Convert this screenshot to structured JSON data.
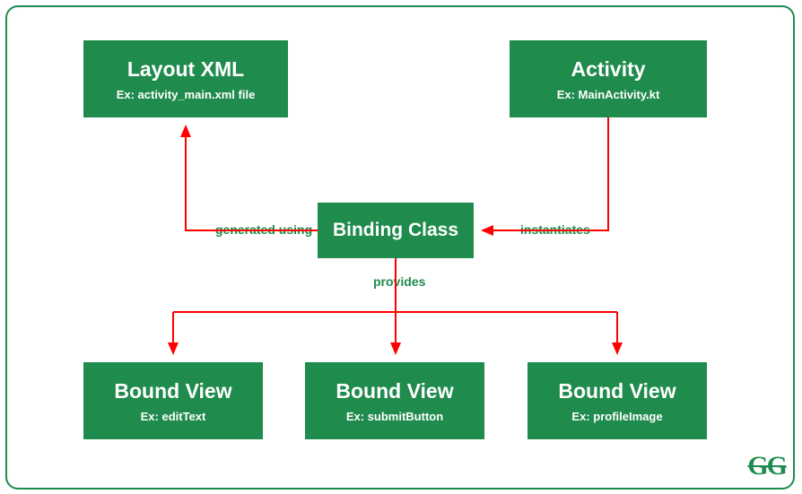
{
  "nodes": {
    "layout_xml": {
      "title": "Layout XML",
      "sub": "Ex: activity_main.xml file"
    },
    "activity": {
      "title": "Activity",
      "sub": "Ex: MainActivity.kt"
    },
    "binding": {
      "title": "Binding Class"
    },
    "bv1": {
      "title": "Bound View",
      "sub": "Ex: editText"
    },
    "bv2": {
      "title": "Bound View",
      "sub": "Ex: submitButton"
    },
    "bv3": {
      "title": "Bound View",
      "sub": "Ex: profileImage"
    }
  },
  "edges": {
    "gen": "generated using",
    "inst": "instantiates",
    "prov": "provides"
  },
  "logo": "GG",
  "colors": {
    "green": "#1f8b4c",
    "arrow": "#ff0000"
  },
  "chart_data": {
    "type": "flow-diagram",
    "nodes": [
      {
        "id": "layout_xml",
        "label": "Layout XML",
        "example": "activity_main.xml file"
      },
      {
        "id": "activity",
        "label": "Activity",
        "example": "MainActivity.kt"
      },
      {
        "id": "binding",
        "label": "Binding Class"
      },
      {
        "id": "bv1",
        "label": "Bound View",
        "example": "editText"
      },
      {
        "id": "bv2",
        "label": "Bound View",
        "example": "submitButton"
      },
      {
        "id": "bv3",
        "label": "Bound View",
        "example": "profileImage"
      }
    ],
    "edges": [
      {
        "from": "binding",
        "to": "layout_xml",
        "label": "generated using"
      },
      {
        "from": "activity",
        "to": "binding",
        "label": "instantiates"
      },
      {
        "from": "binding",
        "to": "bv1",
        "label": "provides"
      },
      {
        "from": "binding",
        "to": "bv2",
        "label": "provides"
      },
      {
        "from": "binding",
        "to": "bv3",
        "label": "provides"
      }
    ]
  }
}
